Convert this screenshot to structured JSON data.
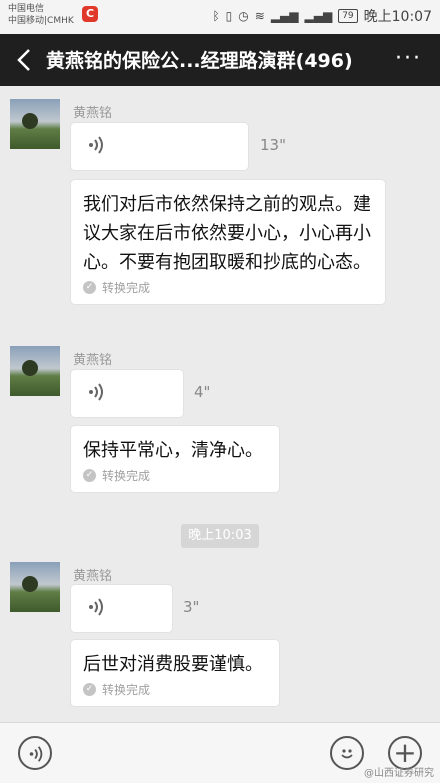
{
  "status": {
    "carrier1": "中国电信",
    "carrier2": "中国移动|CMHK",
    "carrier_badge": "C",
    "battery": "79",
    "time": "晚上10:07"
  },
  "header": {
    "title": "黄燕铭的保险公...经理路演群(496)",
    "more": "···"
  },
  "messages": [
    {
      "sender": "黄燕铭",
      "voice_duration": "13\"",
      "text": "我们对后市依然保持之前的观点。建议大家在后市依然要小心，小心再小心。不要有抱团取暖和抄底的心态。",
      "converted_label": "转换完成"
    },
    {
      "sender": "黄燕铭",
      "voice_duration": "4\"",
      "text": "保持平常心，清净心。",
      "converted_label": "转换完成"
    },
    {
      "sender": "黄燕铭",
      "voice_duration": "3\"",
      "text": "后世对消费股要谨慎。",
      "converted_label": "转换完成"
    }
  ],
  "timestamp": "晚上10:03",
  "watermark": "@山西证券研究"
}
